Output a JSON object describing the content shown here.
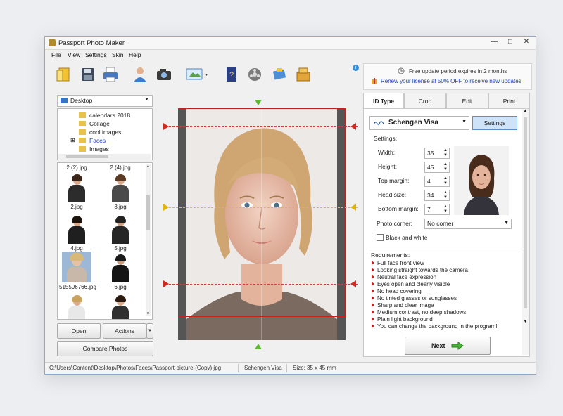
{
  "window": {
    "title": "Passport Photo Maker",
    "controls": [
      "—",
      "□",
      "✕"
    ]
  },
  "menu": [
    "File",
    "View",
    "Settings",
    "Skin",
    "Help"
  ],
  "toolbar": {
    "icons": [
      "open-icon",
      "save-icon",
      "print-icon",
      "person-icon",
      "camera-icon",
      "display-icon",
      "help-book-icon",
      "film-icon",
      "puzzle-icon",
      "boxes-icon"
    ]
  },
  "update": {
    "line1": "Free update period expires in 2 months",
    "line2": "Renew your license at 50% OFF to receive new updates"
  },
  "left": {
    "drive": "Desktop",
    "tree": [
      "calendars 2018",
      "Collage",
      "cool images",
      "Faces",
      "Images"
    ],
    "thumbs": [
      {
        "label": "2 (2).jpg"
      },
      {
        "label": "2 (4).jpg"
      },
      {
        "label": "2.jpg"
      },
      {
        "label": "3.jpg"
      },
      {
        "label": "4.jpg"
      },
      {
        "label": "5.jpg"
      },
      {
        "label": "515596766.jpg"
      },
      {
        "label": "6.jpg"
      },
      {
        "label": ""
      },
      {
        "label": ""
      }
    ],
    "open_label": "Open",
    "actions_label": "Actions",
    "compare_label": "Compare Photos"
  },
  "right": {
    "tabs": [
      "ID Type",
      "Crop",
      "Edit",
      "Print"
    ],
    "active_tab": "ID Type",
    "id_type": "Schengen Visa",
    "settings_button": "Settings",
    "settings_title": "Settings:",
    "fields": [
      {
        "label": "Width:",
        "value": "35"
      },
      {
        "label": "Height:",
        "value": "45"
      },
      {
        "label": "Top margin:",
        "value": "4"
      },
      {
        "label": "Head size:",
        "value": "34"
      },
      {
        "label": "Bottom margin:",
        "value": "7"
      }
    ],
    "photo_corner_label": "Photo corner:",
    "photo_corner_value": "No corner",
    "bw_label": "Black and white",
    "requirements_title": "Requirements:",
    "requirements": [
      "Full face front view",
      "Looking straight towards the camera",
      "Neutral face expression",
      "Eyes open and clearly visible",
      "No head covering",
      "No tinted glasses or sunglasses",
      "Sharp and clear image",
      "Medium contrast, no deep shadows",
      "Plain light background",
      "You can change the background in the program!"
    ],
    "next_label": "Next"
  },
  "status": {
    "path": "C:\\Users\\Content\\Desktop\\Photos\\Faces\\Passport-picture-(Copy).jpg",
    "type": "Schengen Visa",
    "size": "Size: 35 x 45 mm"
  },
  "colors": {
    "accent": "#5a8fca",
    "guide_red": "#d02a20",
    "guide_yellow": "#e3b400",
    "marker_green": "#5cb82e",
    "link": "#1a3fb8"
  }
}
